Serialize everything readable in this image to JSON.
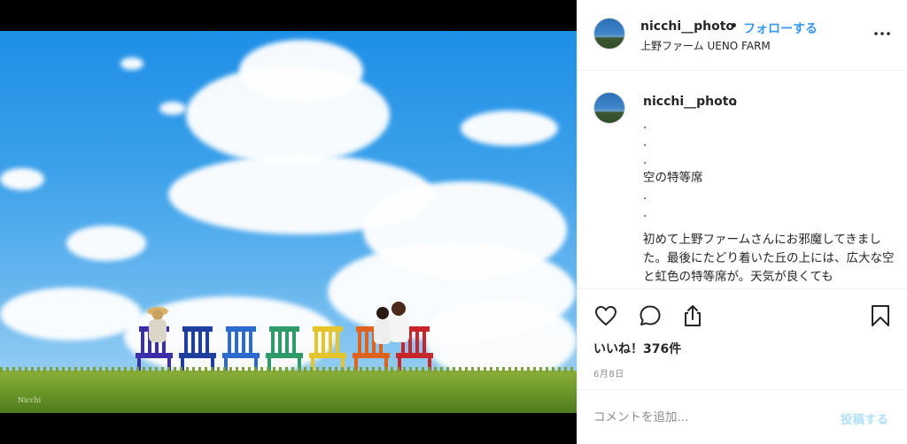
{
  "post": {
    "username": "nicchi__photo",
    "follow_label": "フォローする",
    "separator": "•",
    "location": "上野ファーム UENO FARM",
    "photo_watermark": "Nicchi",
    "chair_colors": [
      "#3a2fa8",
      "#1f3f9e",
      "#2c6ad0",
      "#2f9a6a",
      "#e6c52a",
      "#e0631d",
      "#c8262a"
    ]
  },
  "caption": {
    "username": "nicchi__photo",
    "first_line": ".",
    "lines": [
      ".",
      ".",
      ".",
      "空の特等席",
      ".",
      ".",
      "."
    ],
    "paragraph": "初めて上野ファームさんにお邪魔してきました。最後にたどり着いた丘の上には、広大な空と虹色の特等席が。天気が良くても"
  },
  "actions": {
    "like_icon": "heart-icon",
    "comment_icon": "comment-icon",
    "share_icon": "share-icon",
    "save_icon": "bookmark-icon"
  },
  "likes_text": "いいね！376件",
  "date_text": "6月8日",
  "comment": {
    "placeholder": "コメントを追加...",
    "post_label": "投稿する"
  },
  "colors": {
    "link_blue": "#3897f0",
    "post_disabled": "#b2dffc"
  }
}
